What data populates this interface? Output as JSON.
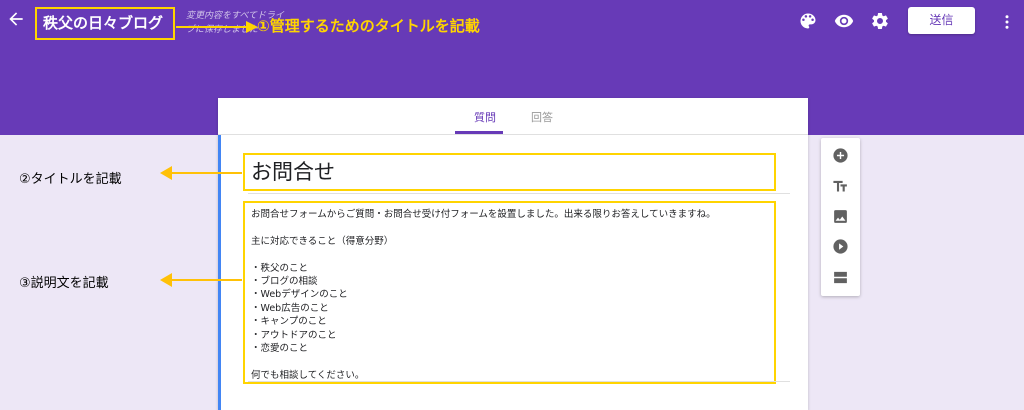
{
  "header": {
    "form_title": "秩父の日々ブログ",
    "saved_status": "変更内容をすべてドライブに保存しました",
    "send_label": "送信",
    "icons": [
      "back-arrow-icon",
      "palette-icon",
      "eye-icon",
      "gear-icon",
      "more-vert-icon"
    ],
    "brand_color": "#673ab7"
  },
  "tabs": [
    {
      "label": "質問",
      "active": true
    },
    {
      "label": "回答",
      "active": false
    }
  ],
  "form": {
    "title": "お問合せ",
    "description": "お問合せフォームからご質問・お問合せ受け付フォームを設置しました。出来る限りお答えしていきますね。\n\n主に対応できること（得意分野）\n\n・秩父のこと\n・ブログの相談\n・Webデザインのこと\n・Web広告のこと\n・キャンプのこと\n・アウトドアのこと\n・恋愛のこと\n\n何でも相談してください。"
  },
  "side_toolbar": [
    "add-question-icon",
    "title-text-icon",
    "image-icon",
    "video-icon",
    "section-icon"
  ],
  "annotations": {
    "a1": "①管理するためのタイトルを記載",
    "a2": "②タイトルを記載",
    "a3": "③説明文を記載",
    "highlight_color": "#ffd400"
  }
}
